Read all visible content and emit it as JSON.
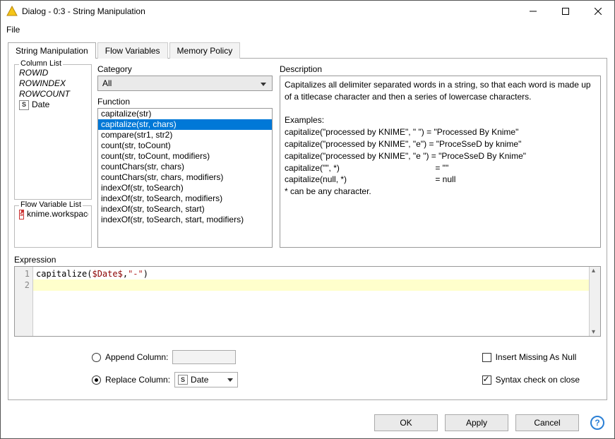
{
  "window": {
    "title": "Dialog - 0:3 - String Manipulation"
  },
  "menu": {
    "file": "File"
  },
  "tabs": {
    "string_manipulation": "String Manipulation",
    "flow_variables": "Flow Variables",
    "memory_policy": "Memory Policy"
  },
  "column_list": {
    "legend": "Column List",
    "rowid": "ROWID",
    "rowindex": "ROWINDEX",
    "rowcount": "ROWCOUNT",
    "date": "Date"
  },
  "flow_var_list": {
    "legend": "Flow Variable List",
    "item": "knime.workspace"
  },
  "category": {
    "label": "Category",
    "selected": "All"
  },
  "function": {
    "label": "Function",
    "items": [
      "capitalize(str)",
      "capitalize(str, chars)",
      "compare(str1, str2)",
      "count(str, toCount)",
      "count(str, toCount, modifiers)",
      "countChars(str, chars)",
      "countChars(str, chars, modifiers)",
      "indexOf(str, toSearch)",
      "indexOf(str, toSearch, modifiers)",
      "indexOf(str, toSearch, start)",
      "indexOf(str, toSearch, start, modifiers)"
    ],
    "selected_index": 1
  },
  "description": {
    "label": "Description",
    "para": "Capitalizes all delimiter separated words in a string, so that each word is made up of a titlecase character and then a series of lowercase characters.",
    "examples_label": "Examples:",
    "ex1": "capitalize(\"processed by KNIME\", \" \")   = \"Processed By Knime\"",
    "ex2": "capitalize(\"processed by KNIME\", \"e\")  = \"ProceSseD by knime\"",
    "ex3": "capitalize(\"processed by KNIME\", \"e \") = \"ProceSseD By Knime\"",
    "ex4_left": "capitalize(\"\", *)",
    "ex4_right": "= \"\"",
    "ex5_left": "capitalize(null, *)",
    "ex5_right": "= null",
    "note": "* can be any character."
  },
  "expression": {
    "label": "Expression",
    "gutter1": "1",
    "gutter2": "2",
    "fn": "capitalize",
    "open": "(",
    "var": "$Date$",
    "comma": ",",
    "str": "\"-\"",
    "close": ")"
  },
  "options": {
    "append_label": "Append Column:",
    "replace_label": "Replace Column:",
    "replace_value": "Date",
    "insert_missing": "Insert Missing As Null",
    "syntax_check": "Syntax check on close"
  },
  "buttons": {
    "ok": "OK",
    "apply": "Apply",
    "cancel": "Cancel"
  },
  "icons": {
    "s": "S",
    "s_red": "s",
    "help": "?"
  }
}
